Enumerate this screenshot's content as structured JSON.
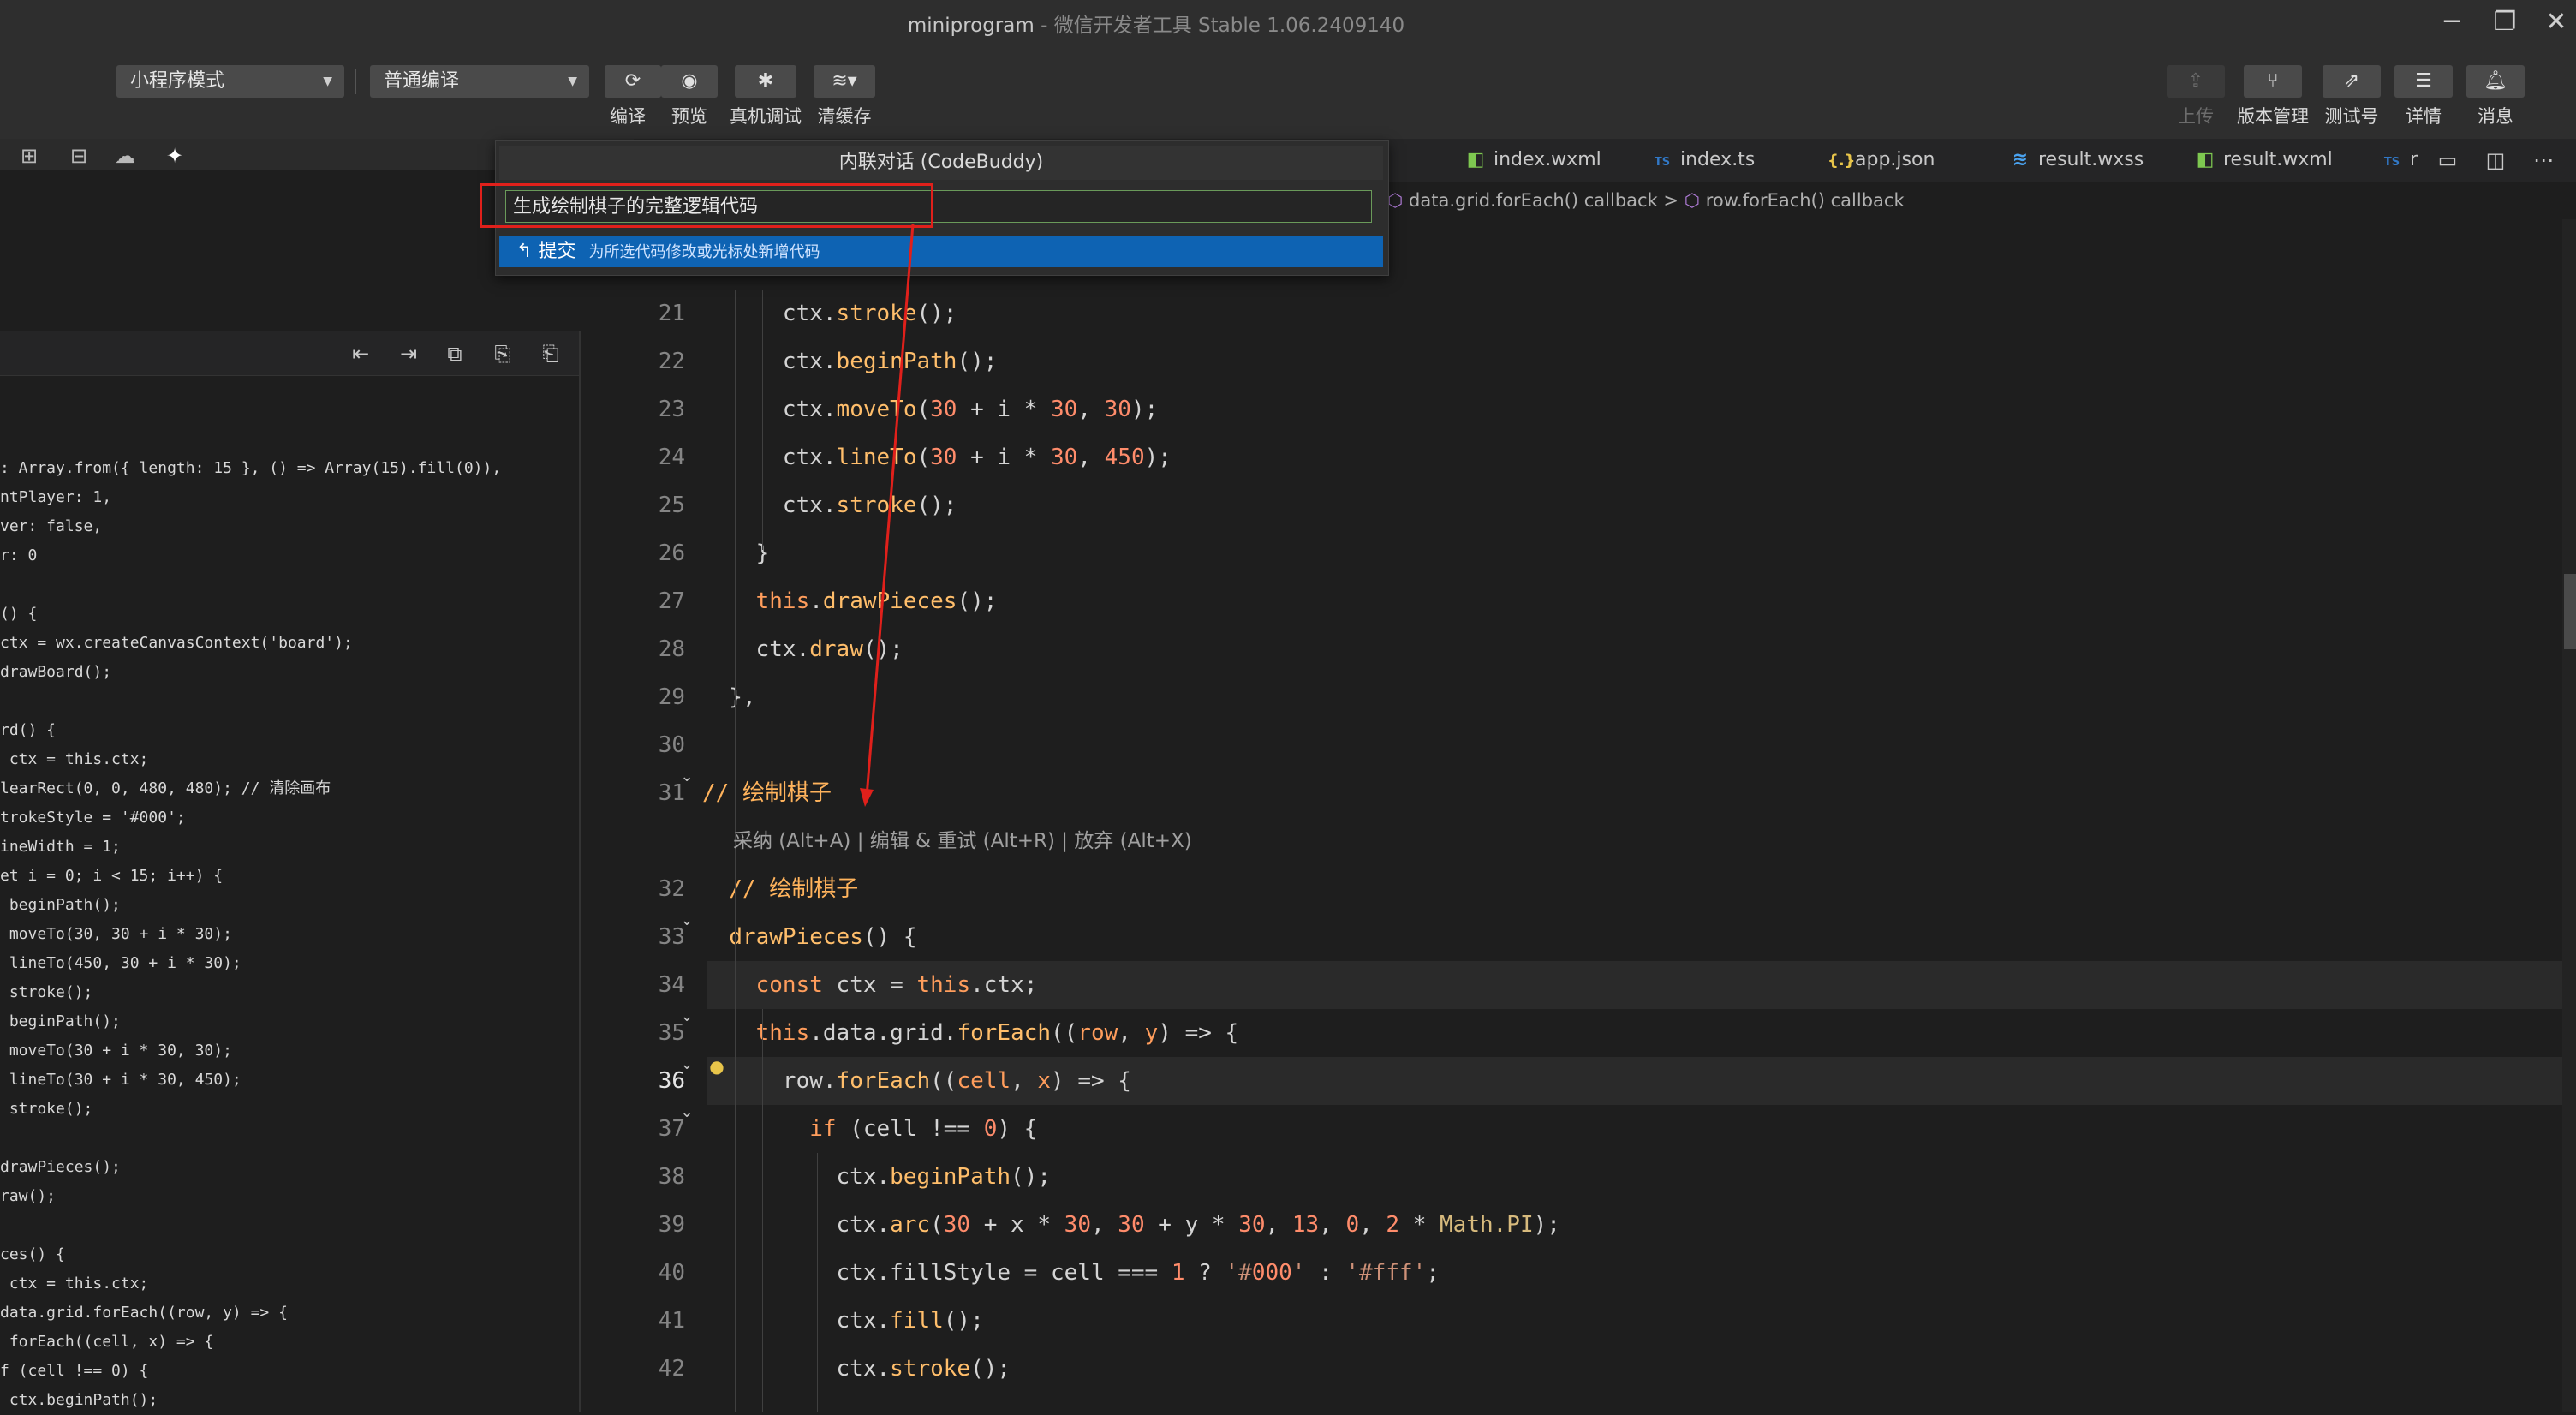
{
  "window": {
    "title": "miniprogram",
    "subtitle": "微信开发者工具 Stable 1.06.2409140",
    "minimize": "─",
    "restore": "❐",
    "close": "✕"
  },
  "toolbar": {
    "mode_select": "小程序模式",
    "compile_select": "普通编译",
    "compile_label": "编译",
    "preview_label": "预览",
    "remote_debug_label": "真机调试",
    "clear_cache_label": "清缓存",
    "upload_label": "上传",
    "version_label": "版本管理",
    "test_label": "测试号",
    "details_label": "详情",
    "messages_label": "消息"
  },
  "tabs": [
    {
      "label": "index.wxml",
      "icon": "wxml-file-icon",
      "glyph": "◧",
      "color": "#7ec850"
    },
    {
      "label": "index.ts",
      "icon": "ts-file-icon",
      "glyph": "TS",
      "color": "#3178c6"
    },
    {
      "label": "app.json",
      "icon": "json-file-icon",
      "glyph": "{.}",
      "color": "#e8c54a"
    },
    {
      "label": "result.wxss",
      "icon": "wxss-file-icon",
      "glyph": "≋",
      "color": "#4aa3f0"
    },
    {
      "label": "result.wxml",
      "icon": "wxml-file-icon",
      "glyph": "◧",
      "color": "#7ec850"
    },
    {
      "label": "r",
      "icon": "ts-file-icon",
      "glyph": "TS",
      "color": "#3178c6"
    }
  ],
  "breadcrumb": {
    "part1": "data.grid.forEach() callback",
    "sep": ">",
    "part2": "row.forEach() callback"
  },
  "dialog": {
    "title": "内联对话 (CodeBuddy)",
    "input_value": "生成绘制棋子的完整逻辑代码",
    "submit_label": "提交",
    "submit_hint": "为所选代码修改或光标处新增代码"
  },
  "codelens": "采纳 (Alt+A) | 编辑 & 重试 (Alt+R) | 放弃 (Alt+X)",
  "editor": {
    "active_line": "36",
    "lines": [
      {
        "n": "21",
        "text": "      ctx.stroke();"
      },
      {
        "n": "22",
        "text": "      ctx.beginPath();"
      },
      {
        "n": "23",
        "text": "      ctx.moveTo(30 + i * 30, 30);"
      },
      {
        "n": "24",
        "text": "      ctx.lineTo(30 + i * 30, 450);"
      },
      {
        "n": "25",
        "text": "      ctx.stroke();"
      },
      {
        "n": "26",
        "text": "    }"
      },
      {
        "n": "27",
        "text": "    this.drawPieces();"
      },
      {
        "n": "28",
        "text": "    ctx.draw();"
      },
      {
        "n": "29",
        "text": "  },"
      },
      {
        "n": "30",
        "text": ""
      },
      {
        "n": "31",
        "text": "// 绘制棋子"
      },
      {
        "n": "32",
        "text": "  // 绘制棋子"
      },
      {
        "n": "33",
        "text": "  drawPieces() {"
      },
      {
        "n": "34",
        "text": "    const ctx = this.ctx;"
      },
      {
        "n": "35",
        "text": "    this.data.grid.forEach((row, y) => {"
      },
      {
        "n": "36",
        "text": "      row.forEach((cell, x) => {"
      },
      {
        "n": "37",
        "text": "        if (cell !== 0) {"
      },
      {
        "n": "38",
        "text": "          ctx.beginPath();"
      },
      {
        "n": "39",
        "text": "          ctx.arc(30 + x * 30, 30 + y * 30, 13, 0, 2 * Math.PI);"
      },
      {
        "n": "40",
        "text": "          ctx.fillStyle = cell === 1 ? '#000' : '#fff';"
      },
      {
        "n": "41",
        "text": "          ctx.fill();"
      },
      {
        "n": "42",
        "text": "          ctx.stroke();"
      }
    ]
  },
  "left_code": [
    ": Array.from({ length: 15 }, () => Array(15).fill(0)),",
    "ntPlayer: 1,",
    "ver: false,",
    "r: 0",
    "",
    "() {",
    "ctx = wx.createCanvasContext('board');",
    "drawBoard();",
    "",
    "rd() {",
    " ctx = this.ctx;",
    "learRect(0, 0, 480, 480); // 清除画布",
    "trokeStyle = '#000';",
    "ineWidth = 1;",
    "et i = 0; i < 15; i++) {",
    " beginPath();",
    " moveTo(30, 30 + i * 30);",
    " lineTo(450, 30 + i * 30);",
    " stroke();",
    " beginPath();",
    " moveTo(30 + i * 30, 30);",
    " lineTo(30 + i * 30, 450);",
    " stroke();",
    "",
    "drawPieces();",
    "raw();",
    "",
    "ces() {",
    " ctx = this.ctx;",
    "data.grid.forEach((row, y) => {",
    " forEach((cell, x) => {",
    "f (cell !== 0) {",
    " ctx.beginPath();"
  ],
  "colors": {
    "accent": "#0e63b3",
    "annotation": "#e0201b",
    "background": "#1e1e1e"
  }
}
